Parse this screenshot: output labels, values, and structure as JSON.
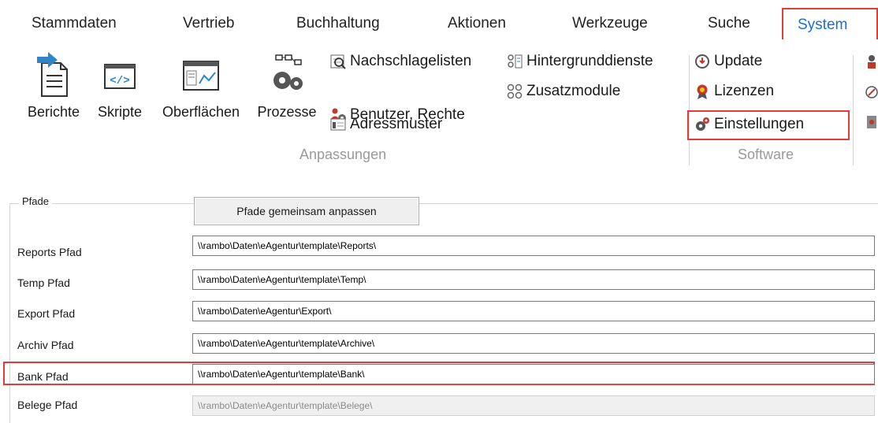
{
  "tabs": [
    "Stammdaten",
    "Vertrieb",
    "Buchhaltung",
    "Aktionen",
    "Werkzeuge",
    "Suche",
    "System"
  ],
  "active_tab": "System",
  "ribbon": {
    "big_buttons": [
      {
        "label": "Berichte",
        "icon": "report-icon"
      },
      {
        "label": "Skripte",
        "icon": "script-icon"
      },
      {
        "label": "Oberflächen",
        "icon": "ui-designer-icon"
      },
      {
        "label": "Prozesse",
        "icon": "process-gears-icon"
      }
    ],
    "anpassungen_small": [
      {
        "label": "Nachschlagelisten",
        "icon": "lookup-list-icon"
      },
      {
        "label": "Benutzer, Rechte",
        "icon": "users-rights-icon"
      },
      {
        "label": "Adressmuster",
        "icon": "address-pattern-icon"
      },
      {
        "label": "Hintergrunddienste",
        "icon": "background-services-icon"
      },
      {
        "label": "Zusatzmodule",
        "icon": "addon-modules-icon"
      }
    ],
    "group_anpassungen": "Anpassungen",
    "software_items": [
      {
        "label": "Update",
        "icon": "update-icon"
      },
      {
        "label": "Lizenzen",
        "icon": "license-icon"
      },
      {
        "label": "Einstellungen",
        "icon": "settings-gears-icon"
      }
    ],
    "group_software": "Software"
  },
  "pfade": {
    "title": "Pfade",
    "adjust_button": "Pfade gemeinsam anpassen",
    "rows": [
      {
        "label": "Reports Pfad",
        "value": "\\\\rambo\\Daten\\eAgentur\\template\\Reports\\"
      },
      {
        "label": "Temp Pfad",
        "value": "\\\\rambo\\Daten\\eAgentur\\template\\Temp\\"
      },
      {
        "label": "Export Pfad",
        "value": "\\\\rambo\\Daten\\eAgentur\\Export\\"
      },
      {
        "label": "Archiv Pfad",
        "value": "\\\\rambo\\Daten\\eAgentur\\template\\Archive\\"
      },
      {
        "label": "Bank Pfad",
        "value": "\\\\rambo\\Daten\\eAgentur\\template\\Bank\\"
      },
      {
        "label": "Belege Pfad",
        "value": "\\\\rambo\\Daten\\eAgentur\\template\\Belege\\"
      }
    ]
  },
  "colors": {
    "accent": "#1a6fd1",
    "highlight": "#e33a3a",
    "group_label": "#9a9a9a"
  }
}
